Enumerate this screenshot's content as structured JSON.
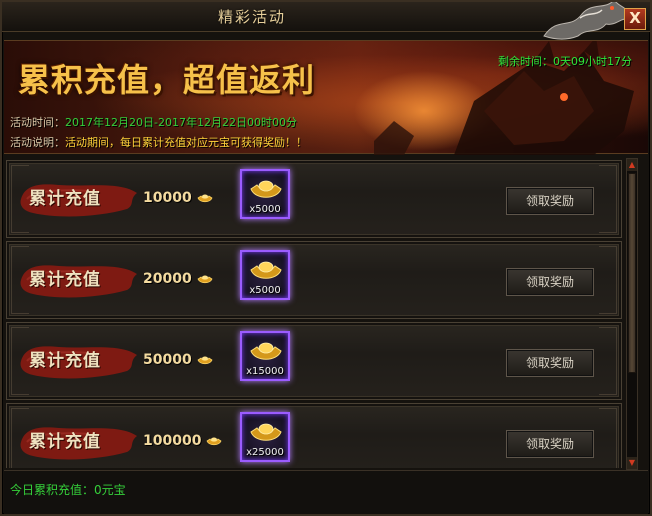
{
  "window": {
    "title": "精彩活动",
    "close_label": "X"
  },
  "banner": {
    "headline": "累积充值，超值返利",
    "countdown_label": "剩余时间：",
    "countdown_value": "0天09小时17分",
    "time_label": "活动时间：",
    "time_value": "2017年12月20日-2017年12月22日00时00分",
    "desc_label": "活动说明：",
    "desc_value": "活动期间，每日累计充值对应元宝可获得奖励！！"
  },
  "rewards": [
    {
      "label": "累计充值",
      "amount": "10000",
      "item_qty": "x5000",
      "claim_label": "领取奖励"
    },
    {
      "label": "累计充值",
      "amount": "20000",
      "item_qty": "x5000",
      "claim_label": "领取奖励"
    },
    {
      "label": "累计充值",
      "amount": "50000",
      "item_qty": "x15000",
      "claim_label": "领取奖励"
    },
    {
      "label": "累计充值",
      "amount": "100000",
      "item_qty": "x25000",
      "claim_label": "领取奖励"
    }
  ],
  "footer": {
    "today_text": "今日累积充值：0元宝"
  },
  "colors": {
    "accent_gold": "#f6c14a",
    "status_green": "#35d03a",
    "rare_purple": "#9b5cff"
  },
  "icons": {
    "currency": "gold-ingot-icon",
    "reward_item": "gold-ingot-icon",
    "close": "close-icon"
  }
}
